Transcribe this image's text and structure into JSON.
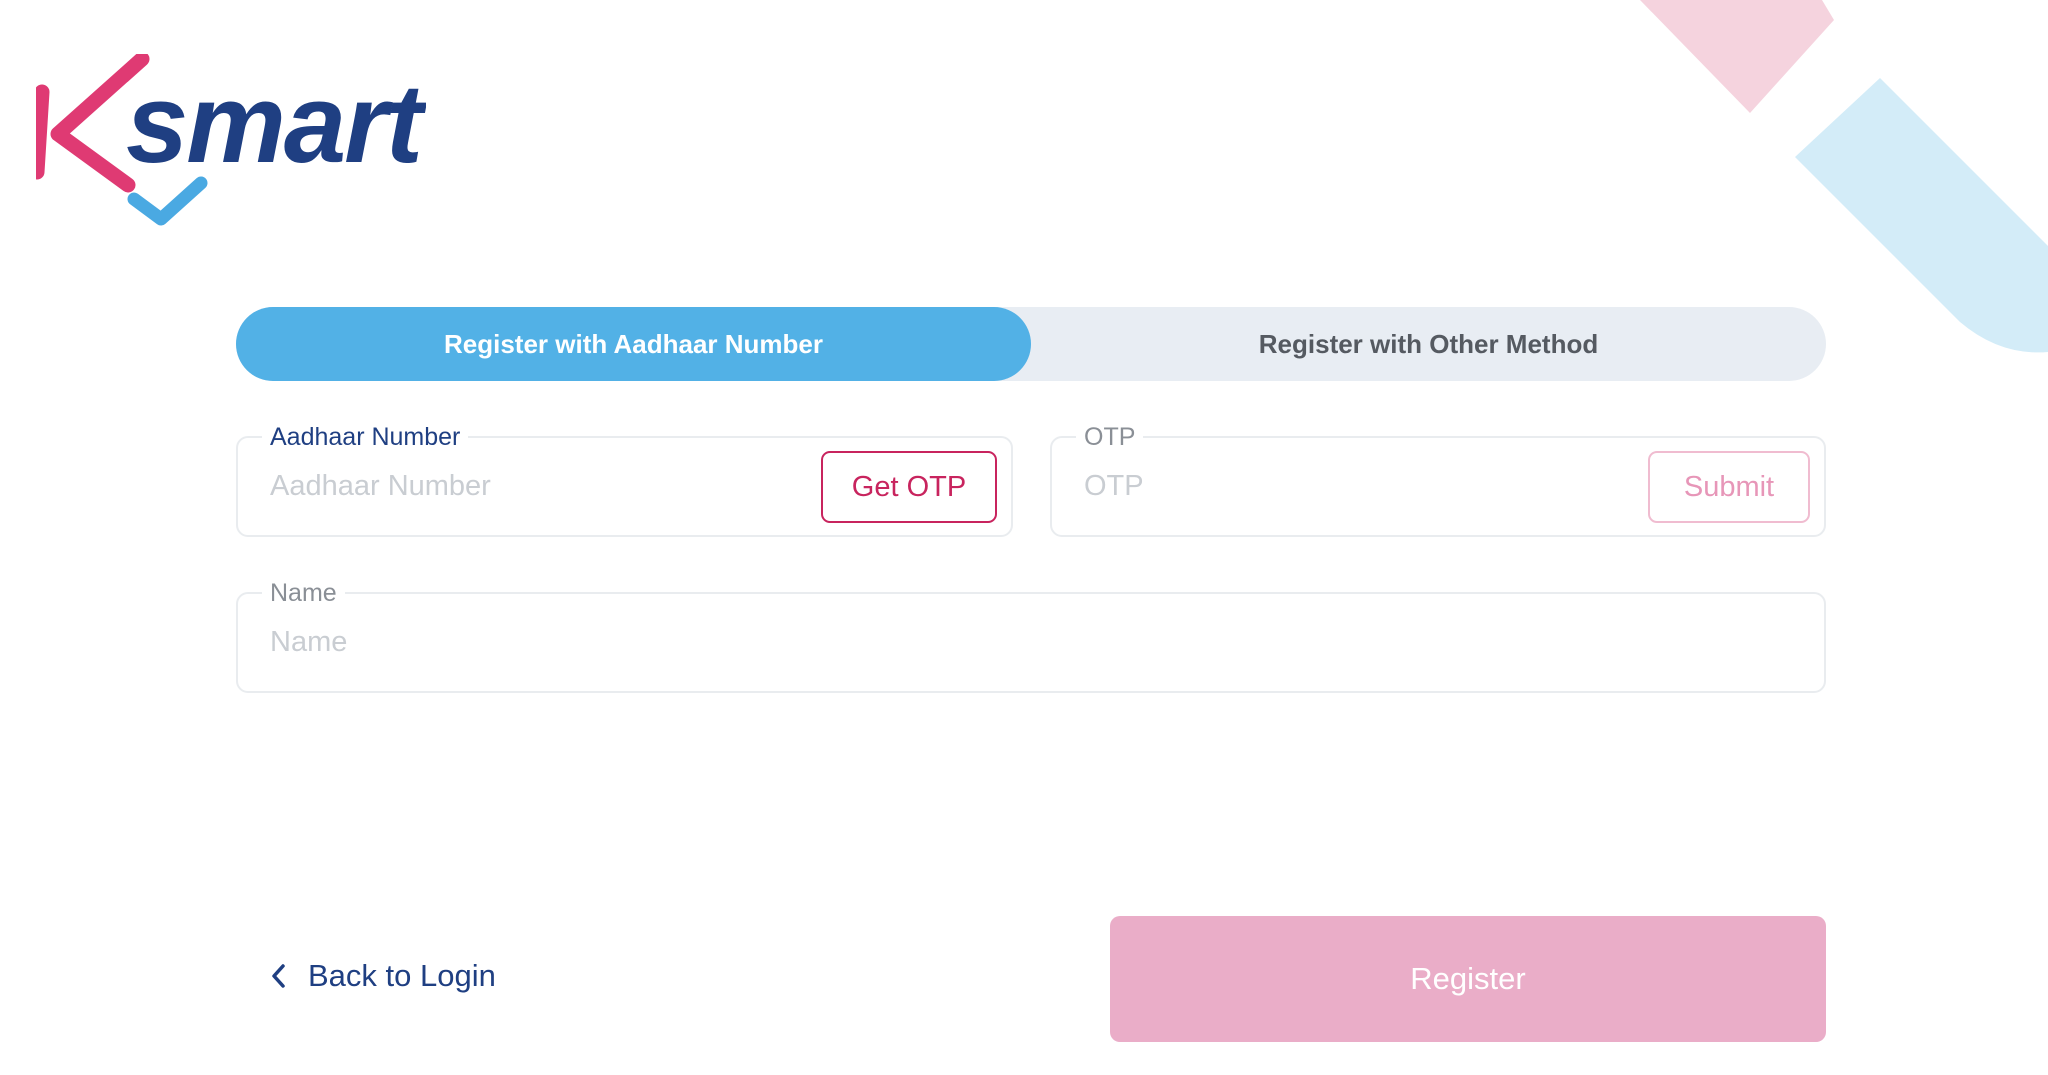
{
  "brand": {
    "logo_text": "smart",
    "logo_letter": "K"
  },
  "tabs": [
    {
      "label": "Register with Aadhaar Number",
      "active": true
    },
    {
      "label": "Register with Other Method",
      "active": false
    }
  ],
  "form": {
    "aadhaar": {
      "label": "Aadhaar Number",
      "placeholder": "Aadhaar Number",
      "value": "",
      "button_label": "Get OTP"
    },
    "otp": {
      "label": "OTP",
      "placeholder": "OTP",
      "value": "",
      "button_label": "Submit"
    },
    "name": {
      "label": "Name",
      "placeholder": "Name",
      "value": ""
    }
  },
  "footer": {
    "back_label": "Back to Login",
    "back_icon": "chevron-left-icon",
    "register_label": "Register"
  },
  "colors": {
    "active_tab": "#52b1e6",
    "inactive_tab_bg": "#e8edf3",
    "primary_text": "#1f3f82",
    "brand_pink": "#c8245e",
    "register_button": "#eaadc8",
    "decoration_pink": "#f5d3de",
    "decoration_blue": "#d3ecf8"
  }
}
